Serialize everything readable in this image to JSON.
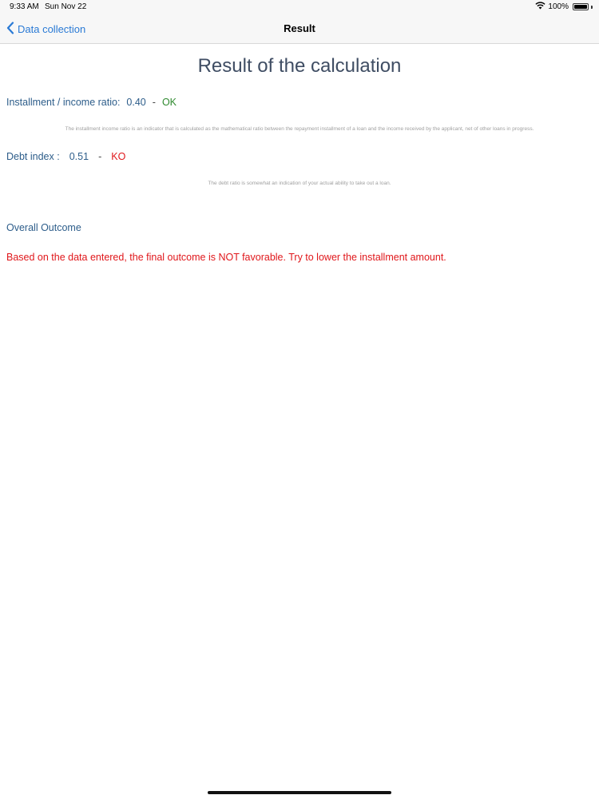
{
  "status_bar": {
    "time": "9:33 AM",
    "date": "Sun Nov 22",
    "battery": "100%",
    "battery_level": 1.0,
    "icons": [
      "wifi-icon",
      "battery-icon"
    ]
  },
  "nav": {
    "back_label": "Data collection",
    "title": "Result",
    "back_icon": "chevron-left-icon"
  },
  "main": {
    "title": "Result of the calculation",
    "installment_ratio": {
      "label": "Installment / income ratio:",
      "value": "0.40",
      "separator": "-",
      "status": "OK",
      "note": "The installment income ratio is an indicator that is calculated as the mathematical ratio between the repayment installment of a loan and the income received by the applicant, net of other loans in progress."
    },
    "debt_index": {
      "label": "Debt index :",
      "value": "0.51",
      "separator": "-",
      "status": "KO",
      "note": "The debt ratio is somewhat an indication of your actual ability to take out a loan."
    },
    "overall": {
      "label": "Overall Outcome",
      "text": "Based on the data entered, the final outcome is NOT favorable. Try to lower the installment amount."
    }
  },
  "colors": {
    "accent": "#2a7ad5",
    "label": "#2d5d8a",
    "ok": "#2f8a2f",
    "ko": "#e0171b",
    "title": "#3f4d63"
  }
}
